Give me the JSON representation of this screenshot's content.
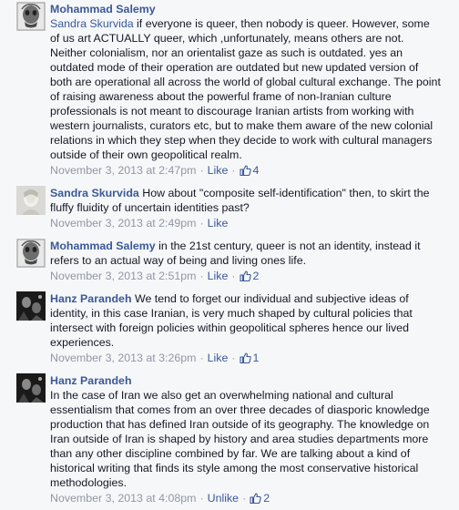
{
  "comments": [
    {
      "author": "Mohammad Salemy",
      "author_on_own_line": true,
      "mention": "Sandra Skurvida",
      "text": " if everyone is queer, then nobody is queer. However, some\nof us art ACTUALLY queer, which ,unfortunately, means others are not.\nNeither colonialism, nor an orientalist gaze as such is outdated. yes an\noutdated mode of their operation are outdated but new updated version of\nboth are operational all across the world of global cultural exchange. The point\nof raising awareness about the powerful frame of non-Iranian culture\nprofessionals is not meant to discourage Iranian artists from working with\nwestern journalists, curators etc, but to make them aware of the new colonial\nrelations in which they step when they decide to work with cultural managers\noutside of their own geopolitical realm.",
      "timestamp": "November 3, 2013 at 2:47pm",
      "action": "Like",
      "likes": "4",
      "avatar_icon": "skull-portrait-avatar"
    },
    {
      "author": "Sandra Skurvida",
      "text": "How about \"composite self-identification\" then, to skirt the\nfluffy fluidity of uncertain identities past?",
      "timestamp": "November 3, 2013 at 2:49pm",
      "action": "Like",
      "avatar_icon": "pale-portrait-avatar"
    },
    {
      "author": "Mohammad Salemy",
      "text": "in the 21st century, queer is not an identity, instead it\nrefers to an actual way of being and living ones life.",
      "timestamp": "November 3, 2013 at 2:51pm",
      "action": "Like",
      "likes": "2",
      "avatar_icon": "skull-portrait-avatar"
    },
    {
      "author": "Hanz Parandeh",
      "text": "We tend to forget our individual and subjective ideas of\nidentity, in this case Iranian, is very much shaped by cultural policies that\nintersect with foreign policies within geopolitical spheres hence our lived\nexperiences.",
      "timestamp": "November 3, 2013 at 3:26pm",
      "action": "Like",
      "likes": "1",
      "avatar_icon": "dark-photo-avatar"
    },
    {
      "author": "Hanz Parandeh",
      "author_on_own_line": true,
      "text": "In the case of Iran we also get an overwhelming national and cultural\nessentialism that comes from an over three decades of diasporic knowledge\nproduction that has defined Iran outside of its geography. The knowledge on\nIran outside of Iran is shaped by history and area studies departments more\nthan any other discipline combined by far. We are talking about a kind of\nhistorical writing that finds its style among the most conservative historical\nmethodologies.",
      "timestamp": "November 3, 2013 at 4:08pm",
      "action": "Unlike",
      "likes": "2",
      "avatar_icon": "dark-photo-avatar"
    }
  ],
  "meta_separator": "·",
  "link_color": "#3b5998",
  "meta_color": "#9197a3"
}
